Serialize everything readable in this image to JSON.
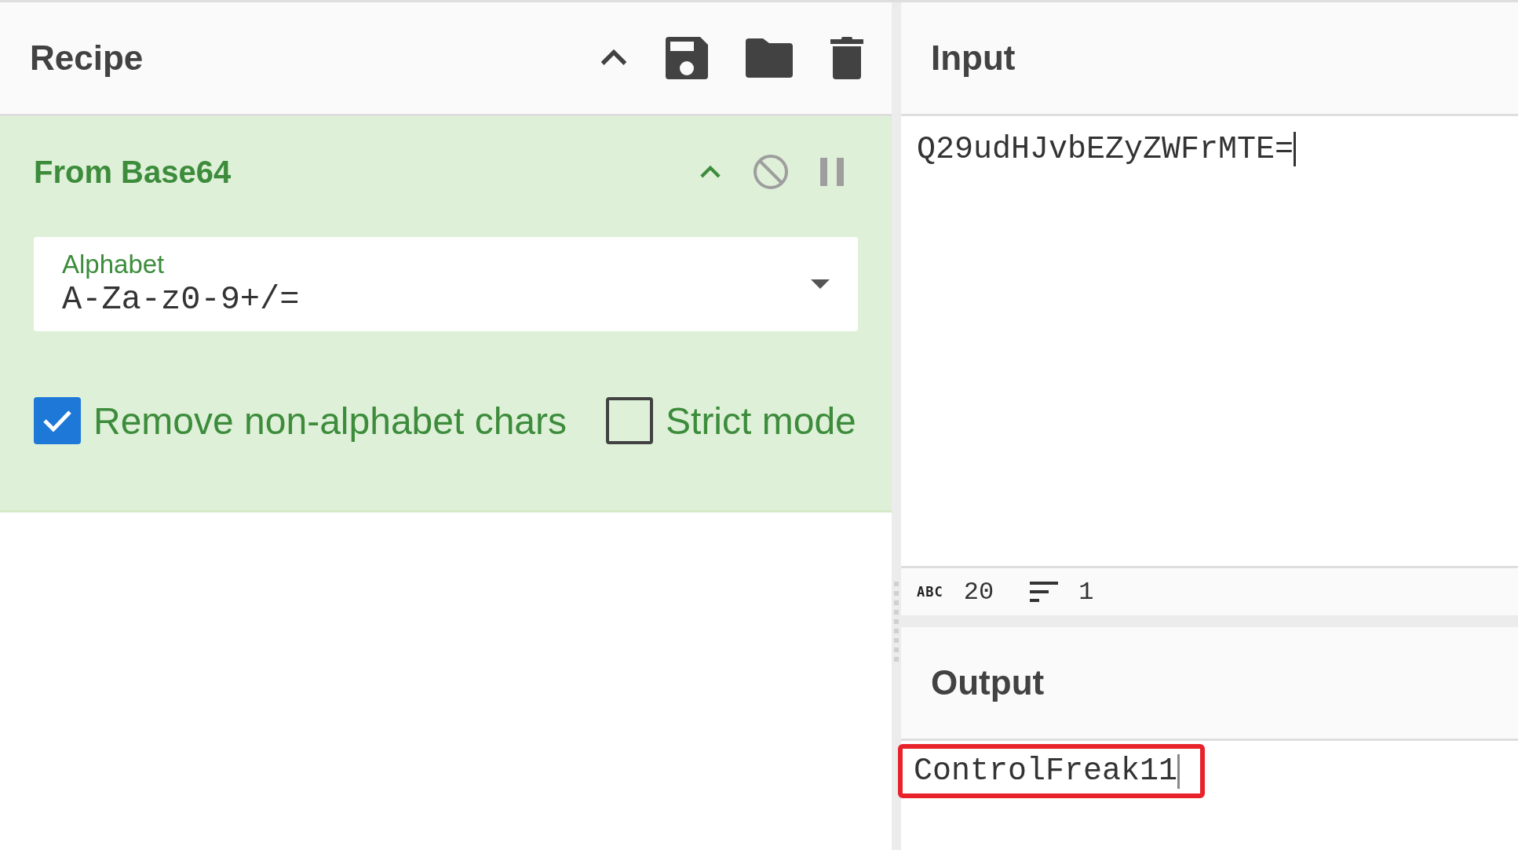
{
  "recipe": {
    "title": "Recipe",
    "operation": {
      "name": "From Base64",
      "disabled": false,
      "paused": false,
      "alphabet": {
        "label": "Alphabet",
        "value": "A-Za-z0-9+/="
      },
      "options": [
        {
          "label": "Remove non-alphabet chars",
          "checked": true
        },
        {
          "label": "Strict mode",
          "checked": false
        }
      ]
    }
  },
  "input": {
    "title": "Input",
    "value": "Q29udHJvbEZyZWFrMTE=",
    "stats": {
      "length_icon": "ABC",
      "length": "20",
      "lines": "1"
    }
  },
  "output": {
    "title": "Output",
    "value": "ControlFreak11",
    "highlighted": true
  }
}
